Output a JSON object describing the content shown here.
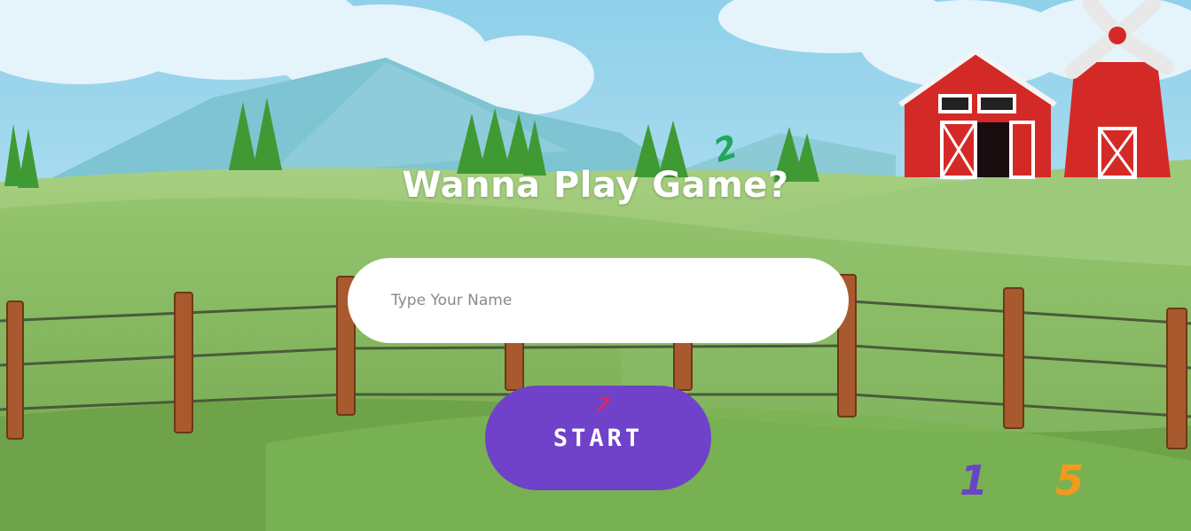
{
  "game": {
    "title": "Wanna Play Game?",
    "name_input": {
      "value": "",
      "placeholder": "Type Your Name"
    },
    "start_label": "START"
  },
  "floating_numbers": [
    "2",
    "7",
    "1",
    "5"
  ],
  "colors": {
    "start_button": "#6f42c9",
    "sky": "#a9dcef",
    "grass": "#7fb35a",
    "barn": "#d42a27",
    "fence": "#a85a2e",
    "number_2": "#1fa85a",
    "number_7": "#d32a6e",
    "number_1": "#6a44c8",
    "number_5": "#f29a1c"
  }
}
